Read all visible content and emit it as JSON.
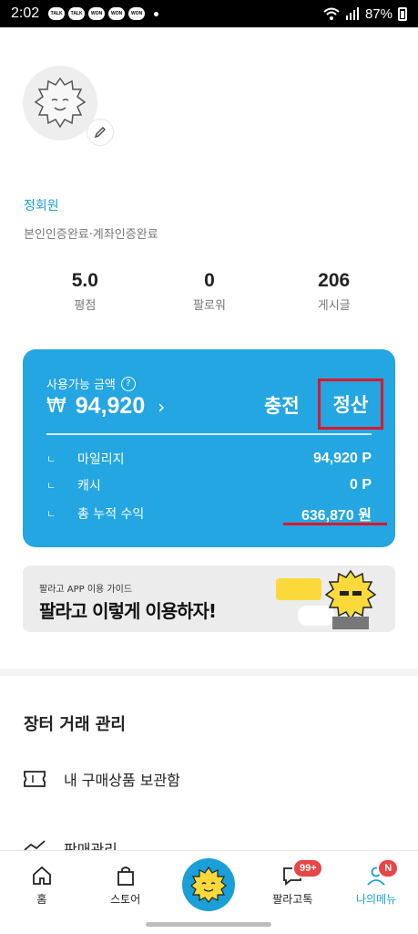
{
  "statusbar": {
    "time": "2:02",
    "notifications": [
      "TALK",
      "TALK",
      "WON",
      "WON",
      "WON"
    ],
    "battery": "87%"
  },
  "profile": {
    "name": "정회원",
    "verification": "본인인증완료·계좌인증완료"
  },
  "stats": [
    {
      "value": "5.0",
      "label": "평점"
    },
    {
      "value": "0",
      "label": "팔로워"
    },
    {
      "value": "206",
      "label": "게시글"
    }
  ],
  "wallet": {
    "available_label": "사용가능 금액",
    "help_icon": "?",
    "currency_symbol": "₩",
    "amount": "94,920",
    "chevron": "›",
    "charge_label": "충전",
    "settle_label": "정산",
    "rows": [
      {
        "label": "마일리지",
        "value": "94,920 P"
      },
      {
        "label": "캐시",
        "value": "0 P"
      },
      {
        "label": "총 누적 수익",
        "value": "636,870 원"
      }
    ],
    "tick": "ㄴ",
    "colors": {
      "background": "#23a6e1",
      "highlight": "#e0162b"
    }
  },
  "banner": {
    "small_text": "팔라고 APP 이용 가이드",
    "headline": "팔라고 이렇게 이용하자!"
  },
  "section": {
    "title": "장터 거래 관리",
    "items": [
      "내 구매상품 보관함",
      "판매관리"
    ]
  },
  "bottom_nav": {
    "items": [
      {
        "label": "홈",
        "icon": "home-icon"
      },
      {
        "label": "스토어",
        "icon": "shopping-bag-icon"
      },
      {
        "label": "",
        "icon": "mascot-icon"
      },
      {
        "label": "팔라고톡",
        "icon": "chat-icon",
        "badge": "99+"
      },
      {
        "label": "나의메뉴",
        "icon": "person-icon",
        "badge": "N"
      }
    ],
    "active_index": 4
  }
}
